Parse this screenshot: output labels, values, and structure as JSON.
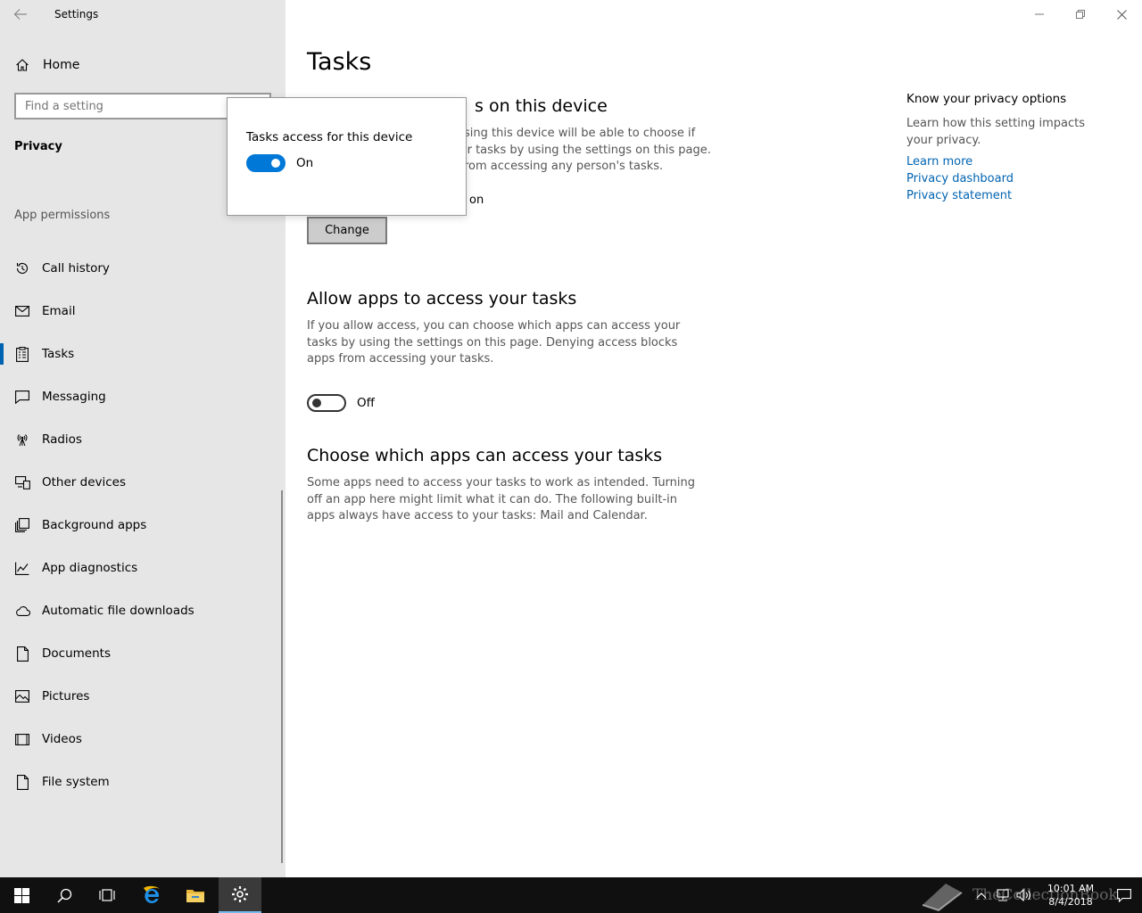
{
  "window": {
    "title": "Settings",
    "controls": {
      "minimize": "minimize-icon",
      "restore": "restore-icon",
      "close": "close-icon"
    }
  },
  "sidebar": {
    "home_label": "Home",
    "search_placeholder": "Find a setting",
    "section_title": "Privacy",
    "group_label": "App permissions",
    "items": [
      {
        "label": "Call history",
        "icon": "history-icon"
      },
      {
        "label": "Email",
        "icon": "mail-icon"
      },
      {
        "label": "Tasks",
        "icon": "tasks-icon",
        "active": true
      },
      {
        "label": "Messaging",
        "icon": "message-icon"
      },
      {
        "label": "Radios",
        "icon": "radio-tower-icon"
      },
      {
        "label": "Other devices",
        "icon": "devices-icon"
      },
      {
        "label": "Background apps",
        "icon": "background-apps-icon"
      },
      {
        "label": "App diagnostics",
        "icon": "diagnostics-icon"
      },
      {
        "label": "Automatic file downloads",
        "icon": "cloud-icon"
      },
      {
        "label": "Documents",
        "icon": "document-icon"
      },
      {
        "label": "Pictures",
        "icon": "picture-icon"
      },
      {
        "label": "Videos",
        "icon": "video-icon"
      },
      {
        "label": "File system",
        "icon": "file-icon"
      }
    ]
  },
  "main": {
    "page_title": "Tasks",
    "device_section": {
      "heading_visible": "s on this device",
      "desc_lines": [
        "sing this device will be able to choose if",
        "ir tasks by using the settings on this page.",
        "rom accessing any person's tasks."
      ],
      "status_visible": "on",
      "change_label": "Change"
    },
    "allow_section": {
      "heading": "Allow apps to access your tasks",
      "desc": "If you allow access, you can choose which apps can access your tasks by using the settings on this page. Denying access blocks apps from accessing your tasks.",
      "toggle_state": "Off"
    },
    "choose_section": {
      "heading": "Choose which apps can access your tasks",
      "desc": "Some apps need to access your tasks to work as intended. Turning off an app here might limit what it can do. The following built-in apps always have access to your tasks: Mail and Calendar."
    },
    "aside": {
      "title": "Know your privacy options",
      "desc": "Learn how this setting impacts your privacy.",
      "links": [
        "Learn more",
        "Privacy dashboard",
        "Privacy statement"
      ]
    }
  },
  "popup": {
    "title": "Tasks access for this device",
    "toggle_state": "On"
  },
  "taskbar": {
    "time": "10:01 AM",
    "date": "8/4/2018",
    "watermark": "TheCollectionBook",
    "accent": "#76b9ed"
  },
  "colors": {
    "accent": "#0078d7",
    "link": "#0063b1",
    "sidebar_bg": "#e6e6e6"
  }
}
